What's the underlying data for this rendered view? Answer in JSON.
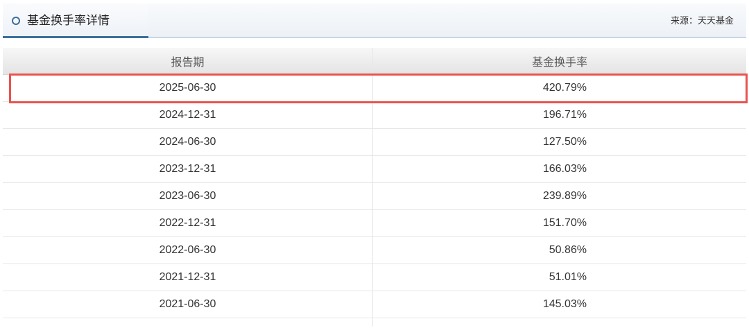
{
  "panel": {
    "title": "基金换手率详情",
    "source": "来源：天天基金"
  },
  "table": {
    "headers": [
      "报告期",
      "基金换手率"
    ],
    "rows": [
      {
        "period": "2025-06-30",
        "rate": "420.79%"
      },
      {
        "period": "2024-12-31",
        "rate": "196.71%"
      },
      {
        "period": "2024-06-30",
        "rate": "127.50%"
      },
      {
        "period": "2023-12-31",
        "rate": "166.03%"
      },
      {
        "period": "2023-06-30",
        "rate": "239.89%"
      },
      {
        "period": "2022-12-31",
        "rate": "151.70%"
      },
      {
        "period": "2022-06-30",
        "rate": "50.86%"
      },
      {
        "period": "2021-12-31",
        "rate": "51.01%"
      },
      {
        "period": "2021-06-30",
        "rate": "145.03%"
      }
    ]
  },
  "highlight": {
    "row_index": 0,
    "color": "#e8534f"
  },
  "colors": {
    "accent": "#3b6f9c",
    "header_bg": "#e4e4e4",
    "highlight_border": "#e8534f"
  }
}
